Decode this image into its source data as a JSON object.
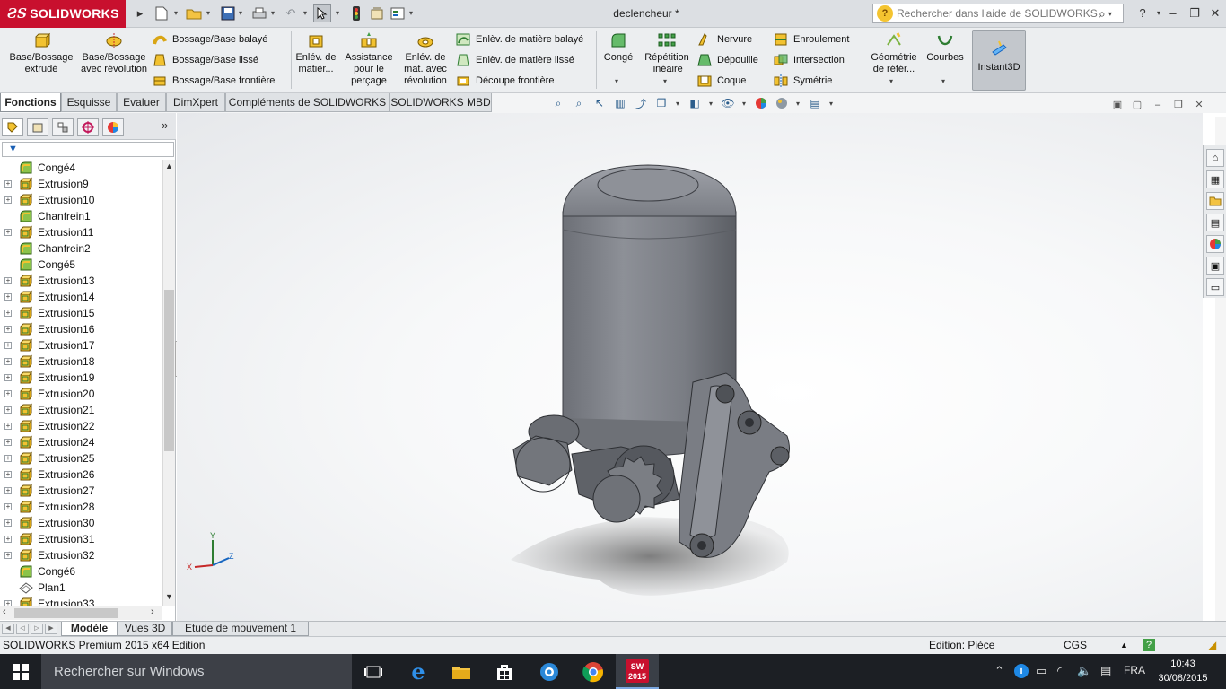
{
  "app": {
    "logo_text": "SOLIDWORKS",
    "doc_title": "declencheur *"
  },
  "help_search": {
    "placeholder": "Rechercher dans l'aide de SOLIDWORKS"
  },
  "ribbon": {
    "base_bossage_extrude": "Base/Bossage extrudé",
    "base_bossage_revolution": "Base/Bossage avec révolution",
    "bossage_balaye": "Bossage/Base balayé",
    "bossage_lisse": "Bossage/Base lissé",
    "bossage_frontiere": "Bossage/Base frontière",
    "enlev_matiere": "Enlév. de matièr...",
    "assistance_percage": "Assistance pour le perçage",
    "enlev_revolution": "Enlév. de mat. avec révolution",
    "enlev_balaye": "Enlèv. de matière balayé",
    "enlev_lisse": "Enlèv. de matière lissé",
    "decoupe_frontiere": "Découpe frontière",
    "conge": "Congé",
    "repetition_lineaire": "Répétition linéaire",
    "nervure": "Nervure",
    "depouille": "Dépouille",
    "coque": "Coque",
    "enroulement": "Enroulement",
    "intersection": "Intersection",
    "symetrie": "Symétrie",
    "geometrie_reference": "Géométrie de référ...",
    "courbes": "Courbes",
    "instant3d": "Instant3D"
  },
  "command_tabs": [
    "Fonctions",
    "Esquisse",
    "Evaluer",
    "DimXpert",
    "Compléments de SOLIDWORKS",
    "SOLIDWORKS MBD"
  ],
  "tree": {
    "more_label": "»",
    "items": [
      {
        "label": "Congé4",
        "type": "fillet",
        "expandable": false
      },
      {
        "label": "Extrusion9",
        "type": "extrude",
        "expandable": true
      },
      {
        "label": "Extrusion10",
        "type": "extrude",
        "expandable": true
      },
      {
        "label": "Chanfrein1",
        "type": "fillet",
        "expandable": false
      },
      {
        "label": "Extrusion11",
        "type": "extrude",
        "expandable": true
      },
      {
        "label": "Chanfrein2",
        "type": "fillet",
        "expandable": false
      },
      {
        "label": "Congé5",
        "type": "fillet",
        "expandable": false
      },
      {
        "label": "Extrusion13",
        "type": "extrude",
        "expandable": true
      },
      {
        "label": "Extrusion14",
        "type": "extrude",
        "expandable": true
      },
      {
        "label": "Extrusion15",
        "type": "extrude",
        "expandable": true
      },
      {
        "label": "Extrusion16",
        "type": "extrude",
        "expandable": true
      },
      {
        "label": "Extrusion17",
        "type": "extrude",
        "expandable": true
      },
      {
        "label": "Extrusion18",
        "type": "extrude",
        "expandable": true
      },
      {
        "label": "Extrusion19",
        "type": "extrude",
        "expandable": true
      },
      {
        "label": "Extrusion20",
        "type": "extrude",
        "expandable": true
      },
      {
        "label": "Extrusion21",
        "type": "extrude",
        "expandable": true
      },
      {
        "label": "Extrusion22",
        "type": "extrude",
        "expandable": true
      },
      {
        "label": "Extrusion24",
        "type": "extrude",
        "expandable": true
      },
      {
        "label": "Extrusion25",
        "type": "extrude",
        "expandable": true
      },
      {
        "label": "Extrusion26",
        "type": "extrude",
        "expandable": true
      },
      {
        "label": "Extrusion27",
        "type": "extrude",
        "expandable": true
      },
      {
        "label": "Extrusion28",
        "type": "extrude",
        "expandable": true
      },
      {
        "label": "Extrusion30",
        "type": "extrude",
        "expandable": true
      },
      {
        "label": "Extrusion31",
        "type": "extrude",
        "expandable": true
      },
      {
        "label": "Extrusion32",
        "type": "extrude",
        "expandable": true
      },
      {
        "label": "Congé6",
        "type": "fillet",
        "expandable": false
      },
      {
        "label": "Plan1",
        "type": "plane",
        "expandable": false
      },
      {
        "label": "Extrusion33",
        "type": "extrude",
        "expandable": true
      }
    ]
  },
  "bottom_tabs": [
    "Modèle",
    "Vues 3D",
    "Etude de mouvement 1"
  ],
  "status": {
    "edition": "SOLIDWORKS Premium 2015 x64 Edition",
    "mode": "Edition: Pièce",
    "units": "CGS"
  },
  "triad": {
    "x": "X",
    "y": "Y",
    "z": "Z"
  },
  "taskbar": {
    "search_placeholder": "Rechercher sur Windows",
    "lang": "FRA",
    "time": "10:43",
    "date": "30/08/2015",
    "sw_badge": "2015"
  },
  "colors": {
    "logo_red": "#c8102e",
    "model_gray": "#7a7c82",
    "ribbon_bg": "#eceef0",
    "taskbar_bg": "#1c1f24"
  }
}
